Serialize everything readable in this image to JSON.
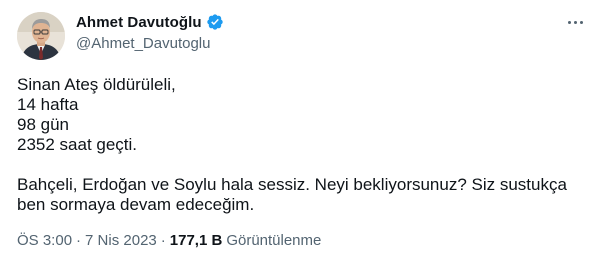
{
  "author": {
    "name": "Ahmet Davutoğlu",
    "handle": "@Ahmet_Davutoglu",
    "verified": true
  },
  "tweet": {
    "lines": [
      "Sinan Ateş öldürüleli,",
      "14 hafta",
      "98 gün",
      "2352 saat geçti.",
      "",
      "Bahçeli, Erdoğan ve Soylu hala sessiz. Neyi bekliyorsunuz? Siz sustukça",
      "ben sormaya devam edeceğim."
    ]
  },
  "meta": {
    "time": "ÖS 3:00",
    "separator_1": "·",
    "date": "7 Nis 2023",
    "separator_2": "·",
    "views_count": "177,1 B",
    "views_label": "Görüntülenme"
  },
  "colors": {
    "text": "#0f1419",
    "secondary": "#536471",
    "verified": "#1d9bf0"
  },
  "icons": {
    "verified": "verified-badge-icon",
    "more": "more-options-icon"
  }
}
